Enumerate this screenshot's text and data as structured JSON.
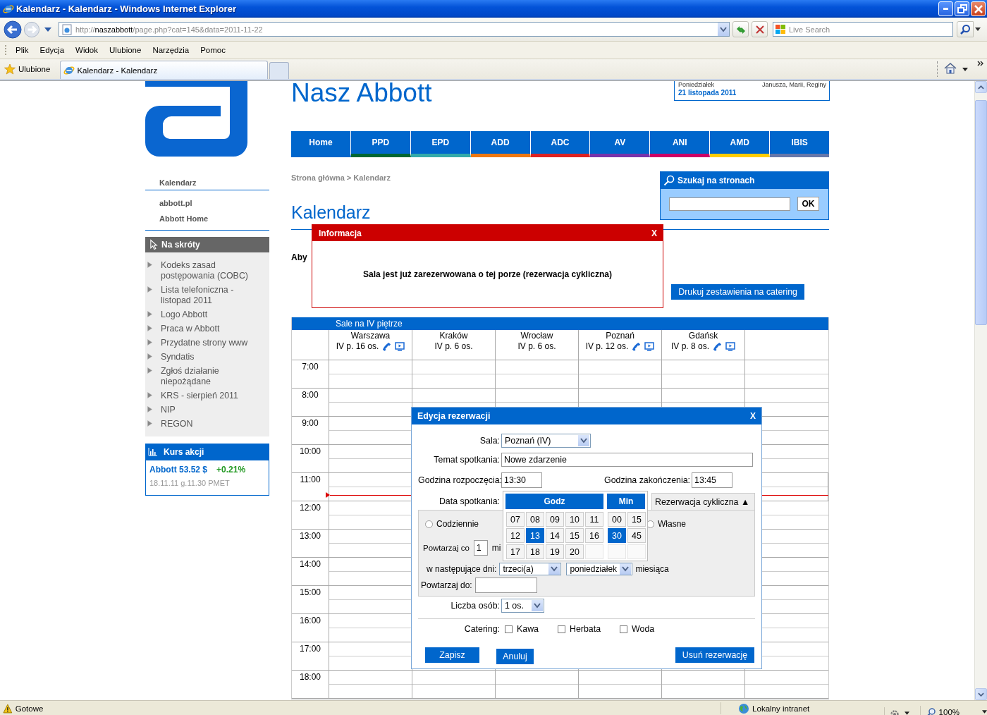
{
  "window": {
    "title": "Kalendarz - Kalendarz - Windows Internet Explorer"
  },
  "address_bar": {
    "scheme": "http://",
    "host": "naszabbott",
    "path": "/page.php?cat=145&data=2011-11-22"
  },
  "search_box": {
    "placeholder": "Live Search"
  },
  "menu_bar": [
    "Plik",
    "Edycja",
    "Widok",
    "Ulubione",
    "Narzędzia",
    "Pomoc"
  ],
  "favorites": {
    "label": "Ulubione"
  },
  "tabs": [
    {
      "label": "Kalendarz - Kalendarz",
      "selected": true
    }
  ],
  "site": {
    "title": "Nasz Abbott",
    "date_box": {
      "day": "Poniedziałek",
      "names": "Janusza, Marii, Reginy",
      "date": "21 listopada 2011"
    },
    "nav": [
      {
        "label": "Home",
        "color": "#0066cc"
      },
      {
        "label": "PPD",
        "color": "#006633"
      },
      {
        "label": "EPD",
        "color": "#33aaaa"
      },
      {
        "label": "ADD",
        "color": "#ee7711"
      },
      {
        "label": "ADC",
        "color": "#dd2222"
      },
      {
        "label": "AV",
        "color": "#7733aa"
      },
      {
        "label": "ANI",
        "color": "#cc0066"
      },
      {
        "label": "AMD",
        "color": "#ffcc00"
      },
      {
        "label": "IBIS",
        "color": "#6677aa"
      }
    ]
  },
  "sidebar": {
    "link_groups": [
      [
        "Kalendarz"
      ],
      [
        "abbott.pl",
        "Abbott Home"
      ]
    ],
    "shortcuts": {
      "title": "Na skróty",
      "items": [
        "Kodeks zasad postępowania (COBC)",
        "Lista telefoniczna - listopad 2011",
        "Logo Abbott",
        "Praca w Abbott",
        "Przydatne strony www",
        "Syndatis",
        "Zgłoś działanie niepożądane",
        "KRS - sierpień 2011",
        "NIP",
        "REGON"
      ]
    },
    "stock": {
      "title": "Kurs akcji",
      "price": "Abbott 53.52 $",
      "change": "+0.21%",
      "time": "18.11.11 g.11.30 PMET"
    }
  },
  "main": {
    "breadcrumb": "Strona główna > Kalendarz",
    "heading": "Kalendarz",
    "intro": "Aby",
    "site_search": {
      "title": "Szukaj na stronach",
      "button": "OK"
    },
    "catering_button": "Drukuj zestawienia na catering"
  },
  "schedule": {
    "title": "Sale na IV piętrze",
    "rooms": [
      {
        "name": "Warszawa",
        "info": "IV p. 16 os.",
        "phone": true,
        "screen": true
      },
      {
        "name": "Kraków",
        "info": "IV p. 6 os.",
        "phone": false,
        "screen": false
      },
      {
        "name": "Wrocław",
        "info": "IV p. 6 os.",
        "phone": false,
        "screen": false
      },
      {
        "name": "Poznań",
        "info": "IV p. 12 os.",
        "phone": true,
        "screen": true
      },
      {
        "name": "Gdańsk",
        "info": "IV p. 8 os.",
        "phone": true,
        "screen": true
      }
    ],
    "hours": [
      {
        "label": "7:00",
        "now": false
      },
      {
        "label": "8:00",
        "now": false
      },
      {
        "label": "9:00",
        "now": false
      },
      {
        "label": "10:00",
        "now": false
      },
      {
        "label": "11:00",
        "now": true
      },
      {
        "label": "12:00",
        "now": false
      },
      {
        "label": "13:00",
        "now": false
      },
      {
        "label": "14:00",
        "now": false
      },
      {
        "label": "15:00",
        "now": false
      },
      {
        "label": "16:00",
        "now": false
      },
      {
        "label": "17:00",
        "now": false
      },
      {
        "label": "18:00",
        "now": false
      }
    ]
  },
  "info_dialog": {
    "title": "Informacja",
    "close": "X",
    "message": "Sala jest już zarezerwowana o tej porze (rezerwacja cykliczna)"
  },
  "edit_dialog": {
    "title": "Edycja rezerwacji",
    "close": "X",
    "room": {
      "label": "Sala:",
      "value": "Poznań (IV)"
    },
    "subject": {
      "label": "Temat spotkania:",
      "value": "Nowe zdarzenie"
    },
    "start": {
      "label": "Godzina rozpoczęcia:",
      "value": "13:30"
    },
    "end": {
      "label": "Godzina zakończenia:",
      "value": "13:45"
    },
    "date": {
      "label": "Data spotkania:"
    },
    "recurrence_toggle": {
      "label": "Rezerwacja cykliczna",
      "arrow": "▲",
      "expanded": true
    },
    "recurrence": {
      "options": [
        {
          "label": "Codziennie",
          "selected": false
        },
        {
          "label": "Własne",
          "selected": false
        }
      ],
      "repeat_every": {
        "label": "Powtarzaj co",
        "value": "1",
        "unit": "mi"
      },
      "days": {
        "label": "w następujące dni:",
        "ordinal": "trzeci(a)",
        "weekday": "poniedziałek",
        "suffix": "miesiąca"
      },
      "repeat_until": {
        "label": "Powtarzaj do:"
      }
    },
    "people": {
      "label": "Liczba osób:",
      "value": "1 os."
    },
    "catering": {
      "label": "Catering:",
      "options": [
        {
          "label": "Kawa",
          "checked": false
        },
        {
          "label": "Herbata",
          "checked": false
        },
        {
          "label": "Woda",
          "checked": false
        }
      ]
    },
    "time_picker": {
      "hours_title": "Godz",
      "minutes_title": "Min",
      "hours": [
        {
          "label": "07",
          "selected": false
        },
        {
          "label": "08",
          "selected": false
        },
        {
          "label": "09",
          "selected": false
        },
        {
          "label": "10",
          "selected": false
        },
        {
          "label": "11",
          "selected": false
        },
        {
          "label": "12",
          "selected": false
        },
        {
          "label": "13",
          "selected": true
        },
        {
          "label": "14",
          "selected": false
        },
        {
          "label": "15",
          "selected": false
        },
        {
          "label": "16",
          "selected": false
        },
        {
          "label": "17",
          "selected": false
        },
        {
          "label": "18",
          "selected": false
        },
        {
          "label": "19",
          "selected": false
        },
        {
          "label": "20",
          "selected": false
        }
      ],
      "minutes": [
        {
          "label": "00",
          "selected": false
        },
        {
          "label": "15",
          "selected": false
        },
        {
          "label": "30",
          "selected": true
        },
        {
          "label": "45",
          "selected": false
        }
      ]
    },
    "buttons": {
      "save": "Zapisz",
      "cancel": "Anuluj",
      "delete": "Usuń rezerwację"
    }
  },
  "status_bar": {
    "text": "Gotowe",
    "zone": "Lokalny intranet",
    "zoom": "100%"
  }
}
